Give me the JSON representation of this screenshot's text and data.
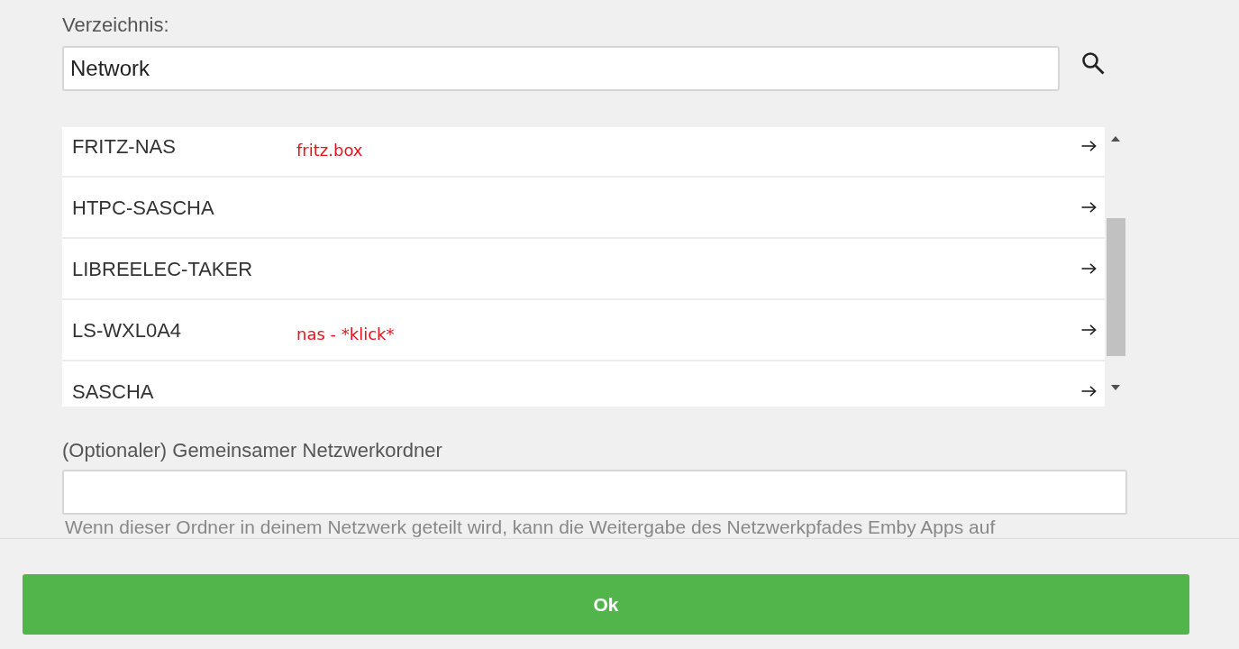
{
  "directory": {
    "label": "Verzeichnis:",
    "value": "Network"
  },
  "network_list": {
    "items": [
      {
        "name": "FRITZ-NAS",
        "annotation": "fritz.box"
      },
      {
        "name": "HTPC-SASCHA"
      },
      {
        "name": "LIBREELEC-TAKER"
      },
      {
        "name": "LS-WXL0A4",
        "annotation": "nas - *klick*"
      },
      {
        "name": "SASCHA"
      }
    ]
  },
  "shared_folder": {
    "label": "(Optionaler) Gemeinsamer Netzwerkordner",
    "help_text": "Wenn dieser Ordner in deinem Netzwerk geteilt wird, kann die Weitergabe des Netzwerkpfades Emby Apps auf"
  },
  "ok_button": {
    "label": "Ok"
  }
}
